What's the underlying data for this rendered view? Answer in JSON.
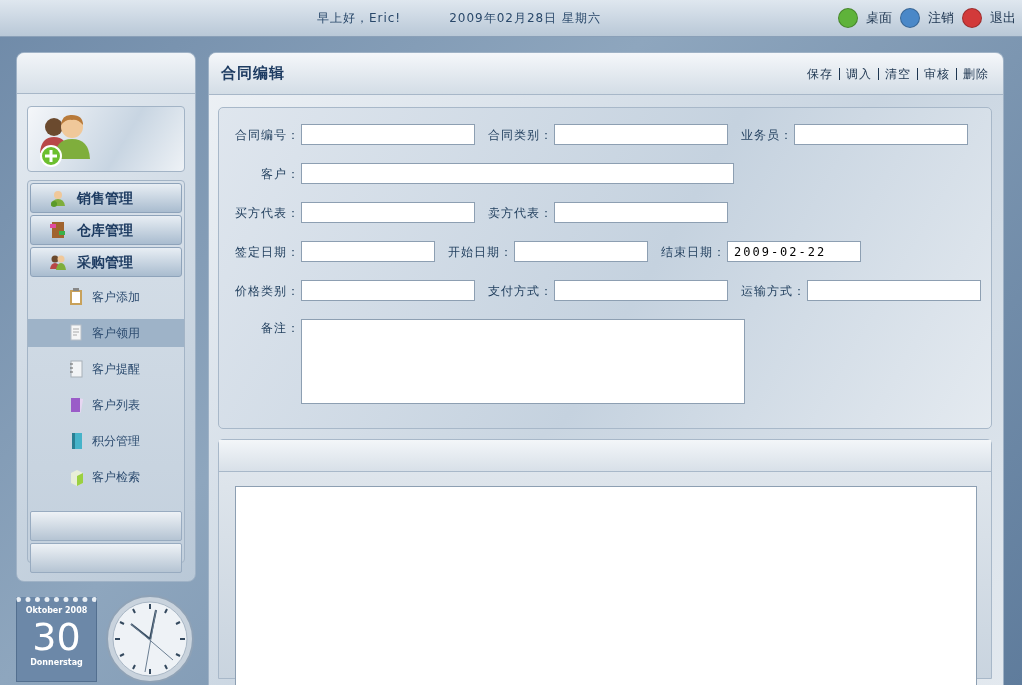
{
  "header": {
    "greeting": "早上好，Eric!",
    "date": "2009年02月28日  星期六",
    "links": [
      {
        "label": "桌面",
        "color": "#5fb33a"
      },
      {
        "label": "注销",
        "color": "#4a88c8"
      },
      {
        "label": "退出",
        "color": "#d23a3a"
      }
    ]
  },
  "sidebar": {
    "menus": [
      {
        "label": "销售管理",
        "kind": "sales"
      },
      {
        "label": "仓库管理",
        "kind": "warehouse"
      },
      {
        "label": "采购管理",
        "kind": "purchase"
      }
    ],
    "items": [
      {
        "label": "客户添加",
        "kind": "clipboard",
        "selected": false
      },
      {
        "label": "客户领用",
        "kind": "page",
        "selected": true
      },
      {
        "label": "客户提醒",
        "kind": "notebook",
        "selected": false
      },
      {
        "label": "客户列表",
        "kind": "papers",
        "selected": false
      },
      {
        "label": "积分管理",
        "kind": "book",
        "selected": false
      },
      {
        "label": "客户检索",
        "kind": "box",
        "selected": false
      }
    ]
  },
  "calendar": {
    "month": "Oktober 2008",
    "day": "30",
    "weekday": "Donnerstag"
  },
  "editor": {
    "title": "合同编辑",
    "actions": [
      "保存",
      "调入",
      "清空",
      "审核",
      "删除"
    ],
    "rows": [
      [
        {
          "label": "合同编号：",
          "kind": "text"
        },
        {
          "label": "合同类别：",
          "kind": "text"
        },
        {
          "label": "业务员：",
          "kind": "text"
        }
      ],
      [
        {
          "label": "客户：",
          "kind": "wide"
        }
      ],
      [
        {
          "label": "买方代表：",
          "kind": "text"
        },
        {
          "label": "卖方代表：",
          "kind": "text"
        }
      ],
      [
        {
          "label": "签定日期：",
          "kind": "date"
        },
        {
          "label": "开始日期：",
          "kind": "date"
        },
        {
          "label": "结束日期：",
          "kind": "date",
          "value": "2009-02-22"
        }
      ],
      [
        {
          "label": "价格类别：",
          "kind": "text"
        },
        {
          "label": "支付方式：",
          "kind": "text"
        },
        {
          "label": "运输方式：",
          "kind": "text"
        }
      ],
      [
        {
          "label": "备注：",
          "kind": "memo"
        }
      ]
    ]
  }
}
